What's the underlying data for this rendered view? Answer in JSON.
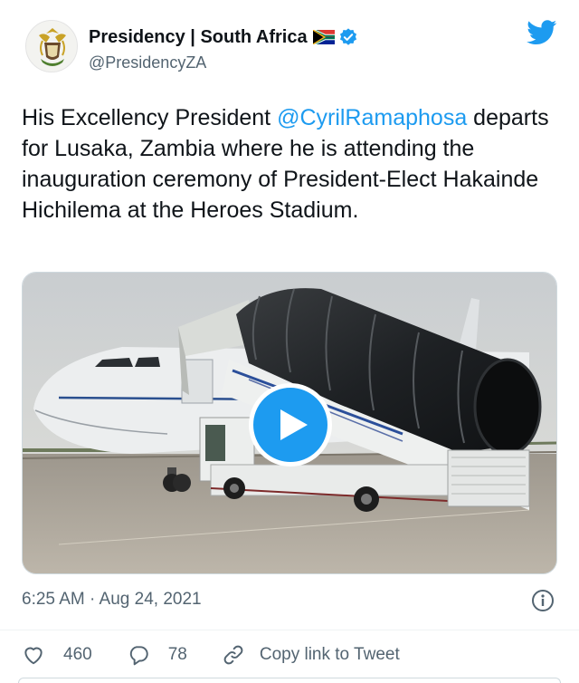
{
  "author": {
    "display_name": "Presidency | South Africa",
    "handle": "@PresidencyZA",
    "flag_icon": "south-africa-flag-icon",
    "verified_icon": "verified-badge-icon",
    "avatar_icon": "coat-of-arms-icon"
  },
  "tweet": {
    "text_part1": "His Excellency President ",
    "mention": "@CyrilRamaphosa",
    "text_part2": " departs for Lusaka, Zambia where he is attending the inauguration ceremony of President-Elect Hakainde Hichilema at the Heroes Stadium."
  },
  "media": {
    "type": "video",
    "play_icon": "play-icon"
  },
  "meta": {
    "timestamp": "6:25 AM · Aug 24, 2021",
    "info_icon": "info-icon"
  },
  "actions": {
    "likes": "460",
    "replies": "78",
    "copy_link": "Copy link to Tweet"
  },
  "colors": {
    "accent": "#1d9bf0",
    "text": "#0f1419",
    "secondary": "#536471"
  }
}
